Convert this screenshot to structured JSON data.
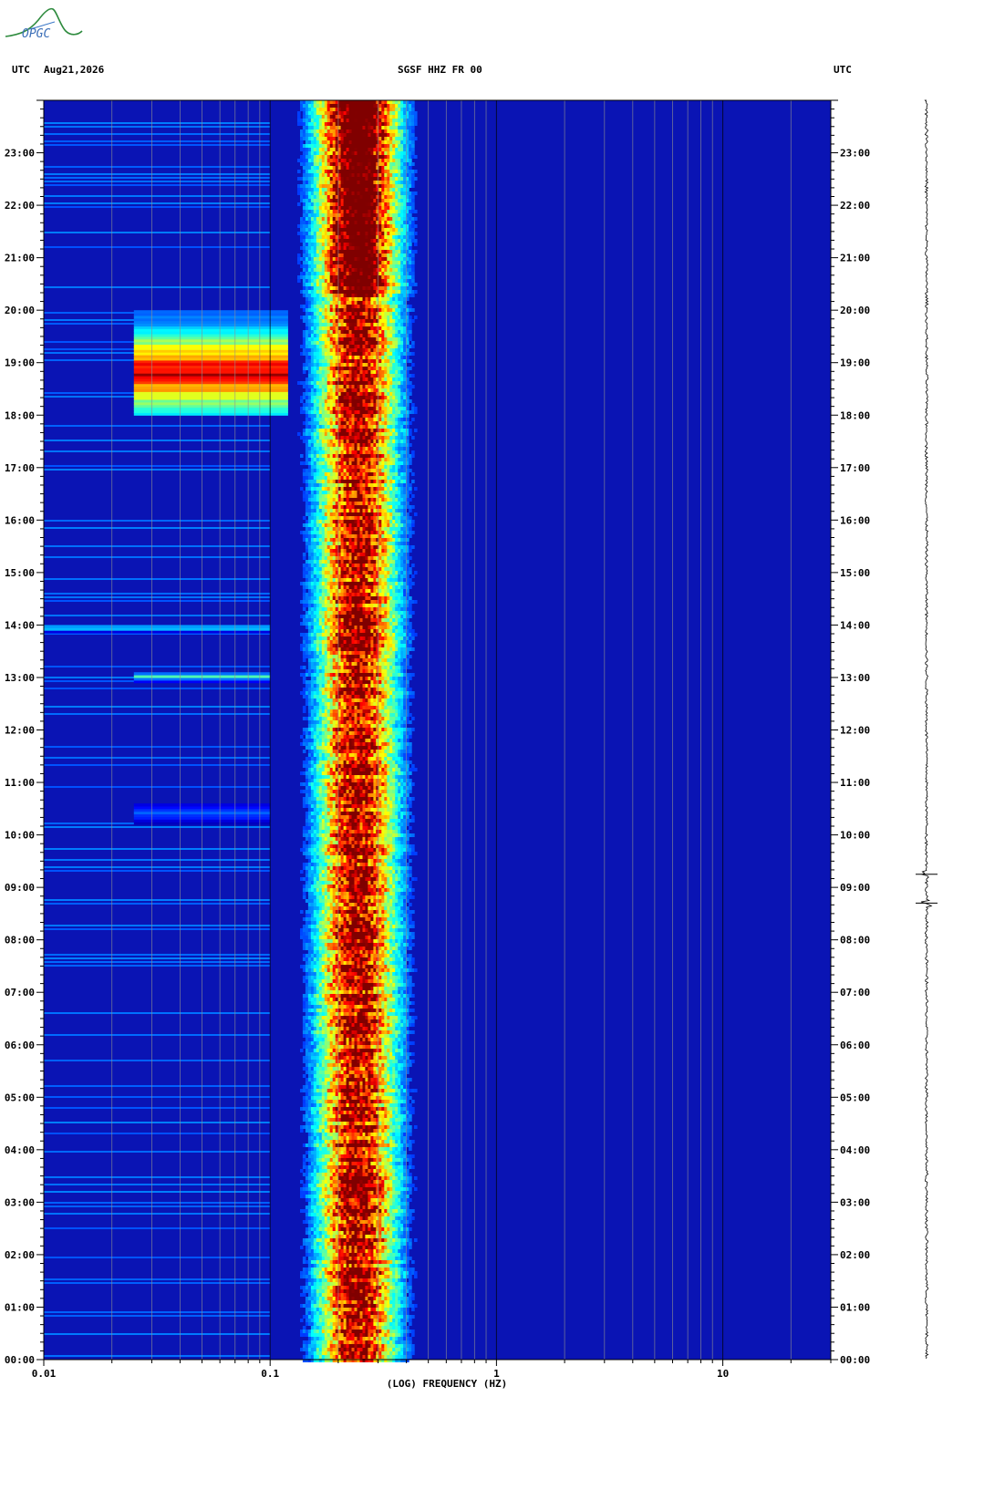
{
  "header": {
    "left_tz": "UTC",
    "date": "Aug21,2026",
    "station": "SGSF HHZ FR 00",
    "right_tz": "UTC",
    "logo_text": "OPGC"
  },
  "chart_data": {
    "type": "heatmap",
    "title": "SGSF HHZ FR 00",
    "xlabel": "(LOG) FREQUENCY (HZ)",
    "ylabel": "UTC",
    "x_scale": "log",
    "xlim": [
      0.01,
      30
    ],
    "x_ticks": [
      {
        "value": 0.01,
        "label": "0.01"
      },
      {
        "value": 0.1,
        "label": "0.1"
      },
      {
        "value": 1,
        "label": "1"
      },
      {
        "value": 10,
        "label": "10"
      }
    ],
    "ylim_hours": [
      0,
      24
    ],
    "y_ticks": [
      "00:00",
      "01:00",
      "02:00",
      "03:00",
      "04:00",
      "05:00",
      "06:00",
      "07:00",
      "08:00",
      "09:00",
      "10:00",
      "11:00",
      "12:00",
      "13:00",
      "14:00",
      "15:00",
      "16:00",
      "17:00",
      "18:00",
      "19:00",
      "20:00",
      "21:00",
      "22:00",
      "23:00"
    ],
    "colormap": [
      "#00008f",
      "#0000ff",
      "#0080ff",
      "#00ffff",
      "#80ff80",
      "#ffff00",
      "#ff8000",
      "#ff0000",
      "#800000"
    ],
    "background_color": "#0a14b4",
    "grid": true,
    "dominant_band_hz": [
      0.15,
      0.45
    ],
    "peak_band_hz": [
      0.22,
      0.28
    ],
    "events": [
      {
        "start_hour": 18.0,
        "end_hour": 20.0,
        "freq_min_hz": 0.025,
        "freq_max_hz": 0.12,
        "peak_hour": 18.8,
        "intensity": 1.0
      },
      {
        "start_hour": 13.85,
        "end_hour": 14.0,
        "freq_min_hz": 0.01,
        "freq_max_hz": 0.1,
        "peak_hour": 13.92,
        "intensity": 0.4
      },
      {
        "start_hour": 12.9,
        "end_hour": 13.1,
        "freq_min_hz": 0.025,
        "freq_max_hz": 0.1,
        "peak_hour": 13.0,
        "intensity": 0.45
      },
      {
        "start_hour": 10.2,
        "end_hour": 10.6,
        "freq_min_hz": 0.025,
        "freq_max_hz": 0.1,
        "peak_hour": 10.4,
        "intensity": 0.25
      }
    ],
    "trace_spikes_hours": [
      9.25,
      8.7
    ]
  }
}
